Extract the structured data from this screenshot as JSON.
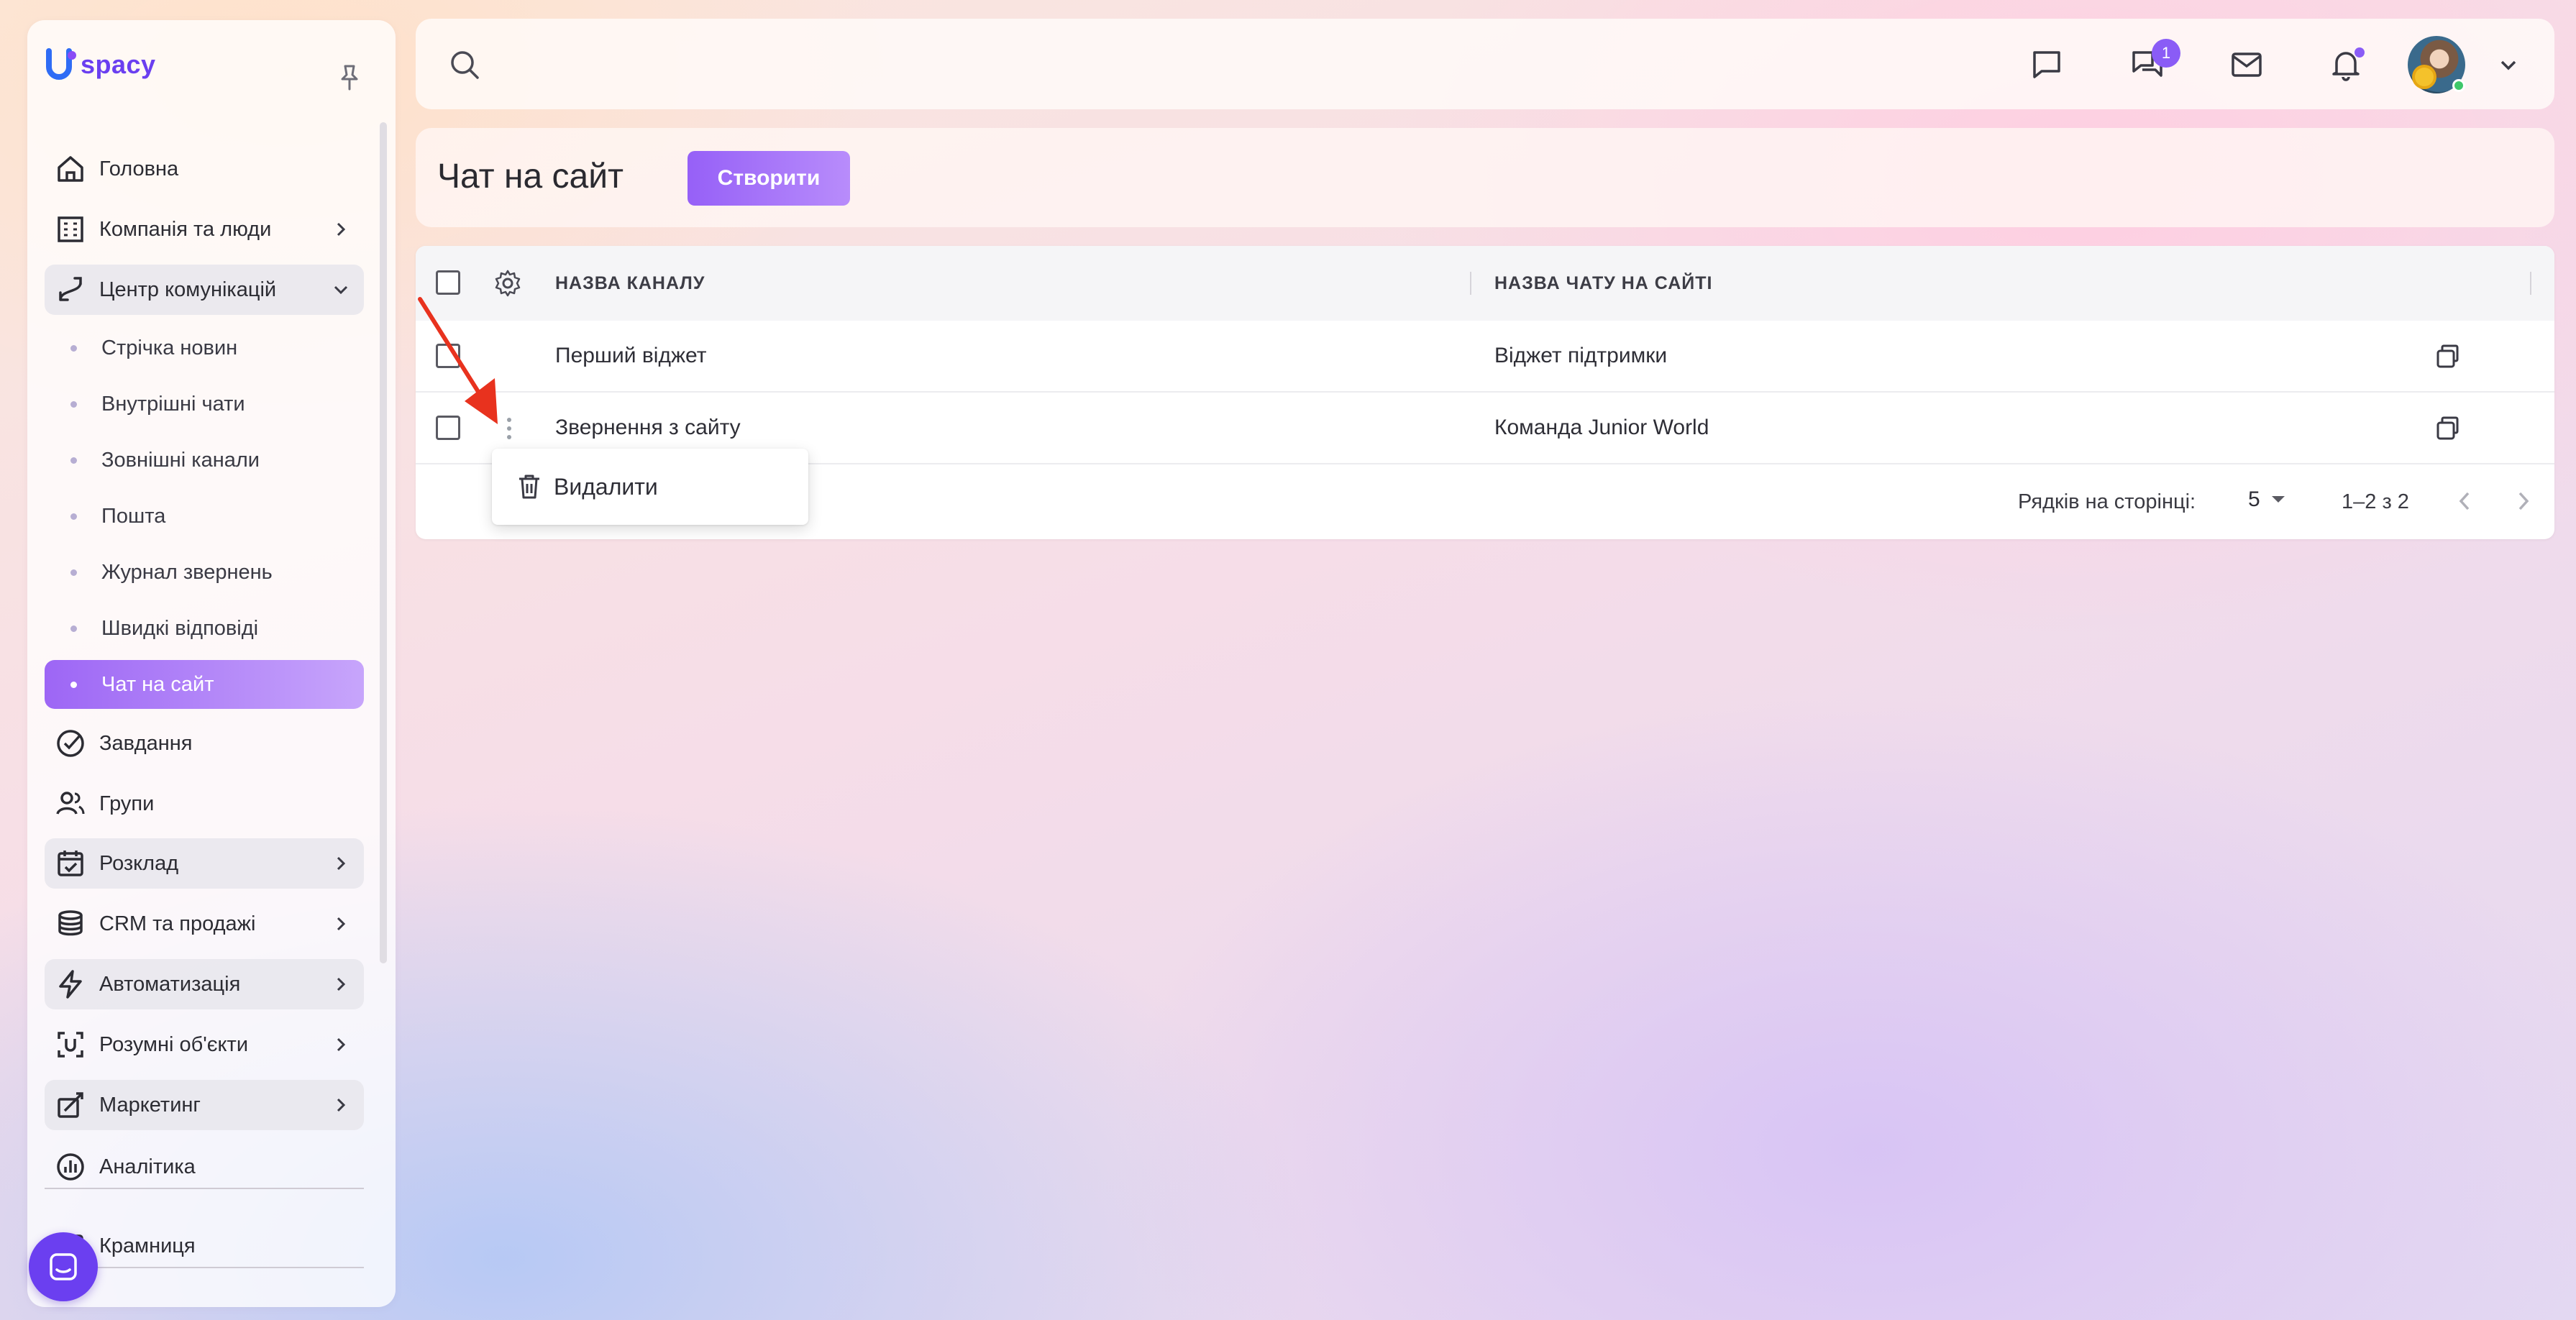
{
  "app": {
    "logo_text": "spacy"
  },
  "sidebar": {
    "items": [
      {
        "label": "Головна",
        "icon": "home-icon"
      },
      {
        "label": "Компанія та люди",
        "icon": "building-icon"
      },
      {
        "label": "Центр комунікацій",
        "icon": "communication-icon"
      },
      {
        "label": "Завдання",
        "icon": "check-circle-icon"
      },
      {
        "label": "Групи",
        "icon": "users-icon"
      },
      {
        "label": "Розклад",
        "icon": "calendar-icon"
      },
      {
        "label": "CRM та продажі",
        "icon": "database-icon"
      },
      {
        "label": "Автоматизація",
        "icon": "lightning-icon"
      },
      {
        "label": "Розумні об'єкти",
        "icon": "smart-object-icon"
      },
      {
        "label": "Маркетинг",
        "icon": "marketing-icon"
      },
      {
        "label": "Аналітика",
        "icon": "analytics-icon"
      },
      {
        "label": "Крамниця",
        "icon": "store-icon"
      }
    ],
    "sub_items": [
      {
        "label": "Стрічка новин"
      },
      {
        "label": "Внутрішні чати"
      },
      {
        "label": "Зовнішні канали"
      },
      {
        "label": "Пошта"
      },
      {
        "label": "Журнал звернень"
      },
      {
        "label": "Швидкі відповіді"
      },
      {
        "label": "Чат на сайт",
        "active": true
      }
    ]
  },
  "header": {
    "chat_badge": "1"
  },
  "page": {
    "title": "Чат на сайт",
    "create_label": "Створити"
  },
  "table": {
    "columns": [
      "НАЗВА КАНАЛУ",
      "НАЗВА ЧАТУ НА САЙТІ"
    ],
    "rows": [
      {
        "channel": "Перший віджет",
        "chat_name": "Віджет підтримки"
      },
      {
        "channel": "Звернення з сайту",
        "chat_name": "Команда Junior World"
      }
    ],
    "footer": {
      "rows_per_page_label": "Рядків на сторінці:",
      "rows_per_page_value": "5",
      "range_text": "1–2 з 2"
    }
  },
  "context_menu": {
    "delete_label": "Видалити"
  },
  "colors": {
    "accent": "#8a5cf6",
    "annotation_arrow": "#e8321e"
  }
}
